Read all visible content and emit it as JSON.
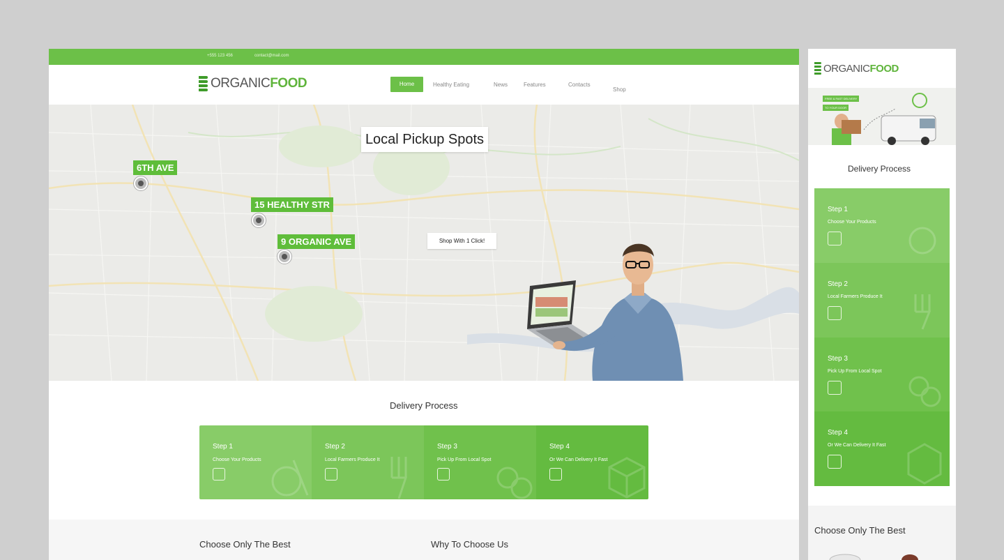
{
  "topbar": {
    "phone": "+555 123 456",
    "email": "contact@mail.com"
  },
  "brand": {
    "organic": "ORGANIC",
    "food": "FOOD"
  },
  "nav": [
    {
      "label": "Home"
    },
    {
      "label": "Healthy Eating"
    },
    {
      "label": "News"
    },
    {
      "label": "Features"
    },
    {
      "label": "Contacts"
    },
    {
      "label": "Shop"
    }
  ],
  "hero": {
    "title": "Local Pickup Spots",
    "shop_button": "Shop With 1 Click!",
    "pins": [
      {
        "label": "6TH AVE"
      },
      {
        "label": "15 HEALTHY STR"
      },
      {
        "label": "9 ORGANIC AVE"
      }
    ]
  },
  "delivery": {
    "title": "Delivery Process",
    "steps": [
      {
        "title": "Step 1",
        "subtitle": "Choose Your Products",
        "color": "#88cc68"
      },
      {
        "title": "Step 2",
        "subtitle": "Local Farmers Produce It",
        "color": "#7cc65a"
      },
      {
        "title": "Step 3",
        "subtitle": "Pick Up From Local Spot",
        "color": "#70c14c"
      },
      {
        "title": "Step 4",
        "subtitle": "Or We Can Delivery It Fast",
        "color": "#64bb40"
      }
    ]
  },
  "bottom": {
    "col1": "Choose Only The Best",
    "col2": "Why To Choose Us"
  },
  "mobile": {
    "banner_badge1": "FREE & FAST DELIVERY",
    "banner_badge2": "TO YOUR DOOR",
    "delivery_title": "Delivery Process",
    "choose_title": "Choose Only The Best"
  },
  "colors": {
    "brand_green": "#6cc048",
    "dark_green": "#3f9c2a",
    "bg_gray": "#cfcfcf"
  }
}
